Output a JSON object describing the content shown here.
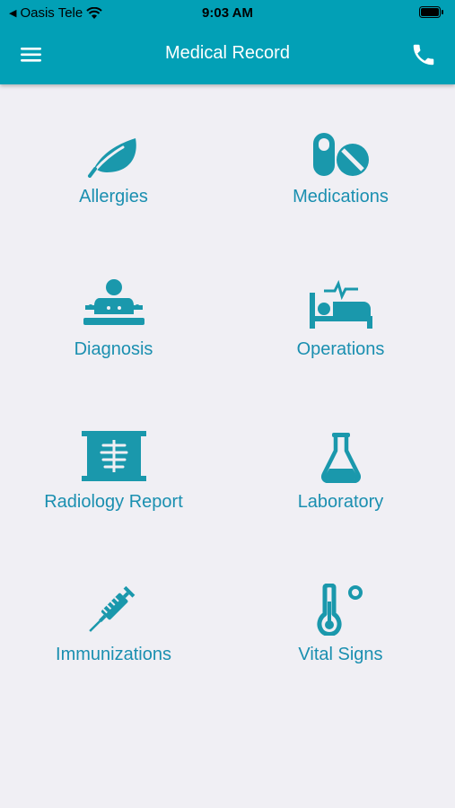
{
  "status_bar": {
    "carrier": "Oasis Tele",
    "time": "9:03 AM"
  },
  "header": {
    "title": "Medical Record"
  },
  "colors": {
    "header": "#02a0b6",
    "icon": "#1a98ac",
    "label": "#1a8fb0",
    "background": "#f0eff4"
  },
  "tiles": [
    {
      "label": "Allergies",
      "icon": "leaf-icon"
    },
    {
      "label": "Medications",
      "icon": "pills-icon"
    },
    {
      "label": "Diagnosis",
      "icon": "patient-exam-icon"
    },
    {
      "label": "Operations",
      "icon": "hospital-bed-icon"
    },
    {
      "label": "Radiology Report",
      "icon": "xray-icon"
    },
    {
      "label": "Laboratory",
      "icon": "flask-icon"
    },
    {
      "label": "Immunizations",
      "icon": "syringe-icon"
    },
    {
      "label": "Vital Signs",
      "icon": "thermometer-icon"
    }
  ]
}
